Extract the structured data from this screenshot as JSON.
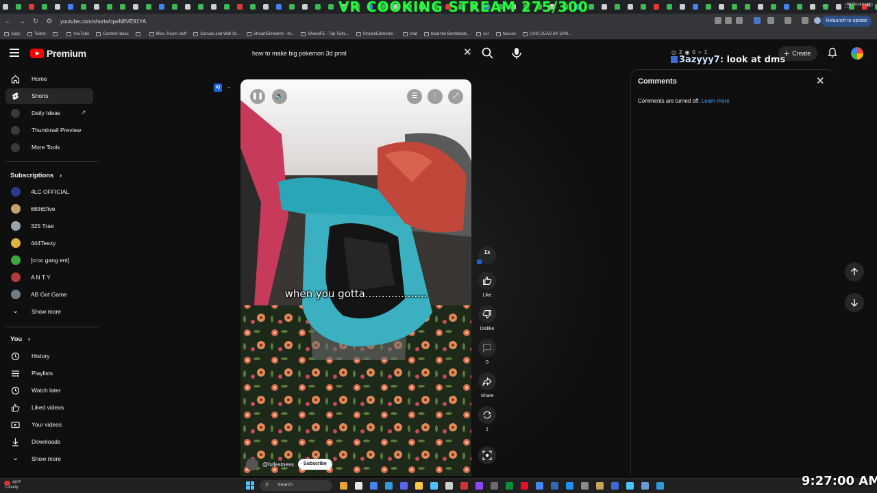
{
  "stream_overlay": {
    "title": "VR COOKING STREAM 275/300",
    "chat_user": "3azyyy7:",
    "chat_message": "look at dms",
    "clock": "9:27:00 AM"
  },
  "browser": {
    "url": "youtube.com/shorts/opeN8VE91YA",
    "relaunch_label": "Relaunch to update",
    "bookmarks": [
      "Apps",
      "Twitch",
      "",
      "YouTube",
      "Content Ideas",
      "",
      "Misc. Room stuff",
      "Canvas and Wall St...",
      "StreamElements - M...",
      "SheedFE - Top Twitc...",
      "StreamElements -",
      "chat",
      "Beat the Bombbeat...",
      "ocr",
      "houses",
      "(103) DEAD BY DAN..."
    ],
    "all_bookmarks": "All Bookmarks"
  },
  "header": {
    "logo_text": "Premium",
    "search_value": "how to make big pokemon 3d print",
    "search_placeholder": "Search",
    "stats": [
      "2",
      "0",
      "1"
    ],
    "create_label": "Create"
  },
  "sidebar": {
    "top_items": [
      {
        "label": "Home",
        "icon": "home-icon"
      },
      {
        "label": "Shorts",
        "icon": "shorts-icon"
      },
      {
        "label": "Daily Ideas",
        "icon": "daily-ideas-icon"
      },
      {
        "label": "Thumbnail Preview",
        "icon": "thumbnail-icon"
      },
      {
        "label": "More Tools",
        "icon": "tools-icon"
      }
    ],
    "subscriptions_label": "Subscriptions",
    "subscriptions": [
      {
        "label": "4LC OFFICIAL",
        "color": "#2b3a8a"
      },
      {
        "label": "68thEfive",
        "color": "#c8a070"
      },
      {
        "label": "325 Trae",
        "color": "#9aa4ad"
      },
      {
        "label": "444Teezy",
        "color": "#e0b43a"
      },
      {
        "label": "[croc gang ent]",
        "color": "#3ca83c"
      },
      {
        "label": "A N T Y",
        "color": "#b53a3a"
      },
      {
        "label": "AB Got Game",
        "color": "#6b7d8a"
      }
    ],
    "subs_show_more": "Show more",
    "you_label": "You",
    "you_items": [
      {
        "label": "History",
        "icon": "history-icon"
      },
      {
        "label": "Playlists",
        "icon": "playlists-icon"
      },
      {
        "label": "Watch later",
        "icon": "watch-later-icon"
      },
      {
        "label": "Liked videos",
        "icon": "liked-icon"
      },
      {
        "label": "Your videos",
        "icon": "your-videos-icon"
      },
      {
        "label": "Downloads",
        "icon": "download-icon"
      }
    ],
    "you_show_more": "Show more"
  },
  "short": {
    "caption": "when you gotta...................",
    "channel_handle": "@fullestness",
    "subscribe_label": "Subscribe",
    "speed_label": "1x"
  },
  "actions": {
    "like_label": "Like",
    "dislike_label": "Dislike",
    "comments_count": "0",
    "share_label": "Share",
    "remix_count": "1"
  },
  "comments": {
    "title": "Comments",
    "off_text": "Comments are turned off.",
    "learn_more": "Learn more"
  },
  "taskbar": {
    "temp": "49°F",
    "weather": "Cloudy",
    "search_label": "Search"
  },
  "colors": {
    "accent_red": "#ff0000",
    "link_blue": "#3ea6ff",
    "overlay_green": "#23ff3a"
  }
}
